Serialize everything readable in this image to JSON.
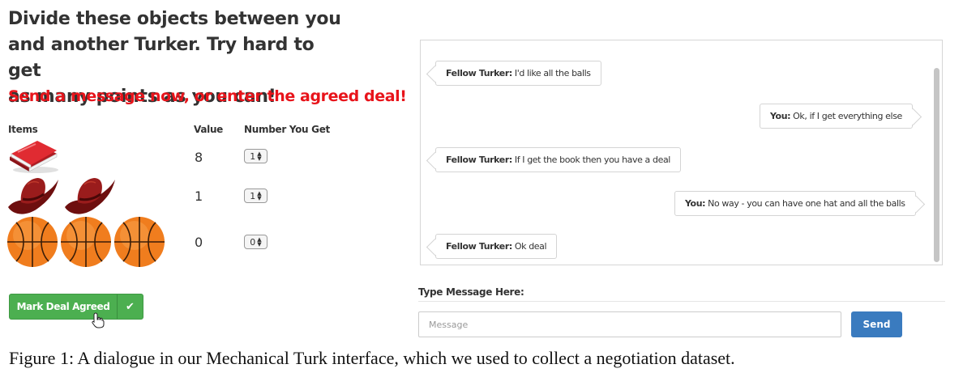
{
  "instructions": {
    "line1": "Divide these objects between you",
    "line2": "and another Turker. Try hard to get",
    "line3": "as many points as you can!",
    "alert": "Send a message now, or enter the agreed deal!"
  },
  "table": {
    "headers": {
      "items": "Items",
      "value": "Value",
      "number": "Number You Get"
    },
    "rows": [
      {
        "item": "book",
        "icon": "book-icon",
        "count": 1,
        "value": "8",
        "get": "1"
      },
      {
        "item": "hat",
        "icon": "hat-icon",
        "count": 2,
        "value": "1",
        "get": "1"
      },
      {
        "item": "ball",
        "icon": "basketball-icon",
        "count": 3,
        "value": "0",
        "get": "0"
      }
    ]
  },
  "deal_button": {
    "label": "Mark Deal Agreed",
    "icon": "check-icon"
  },
  "chat": {
    "messages": [
      {
        "speaker": "Fellow Turker:",
        "text": "I'd like all the balls",
        "side": "left"
      },
      {
        "speaker": "You:",
        "text": "Ok, if I get everything else",
        "side": "right"
      },
      {
        "speaker": "Fellow Turker:",
        "text": "If I get the book then you have a deal",
        "side": "left"
      },
      {
        "speaker": "You:",
        "text": "No way - you can have one hat and all the balls",
        "side": "right"
      },
      {
        "speaker": "Fellow Turker:",
        "text": "Ok deal",
        "side": "left"
      }
    ]
  },
  "composer": {
    "label": "Type Message Here:",
    "placeholder": "Message",
    "value": "",
    "send_label": "Send"
  },
  "caption": "Figure 1: A dialogue in our Mechanical Turk interface, which we used to collect a negotiation dataset.",
  "colors": {
    "alert": "#e8141b",
    "deal_button": "#4caf50",
    "send_button": "#3a7bbf",
    "book": "#d4232b",
    "hat": "#8b1a1a",
    "ball": "#f07d1e"
  }
}
